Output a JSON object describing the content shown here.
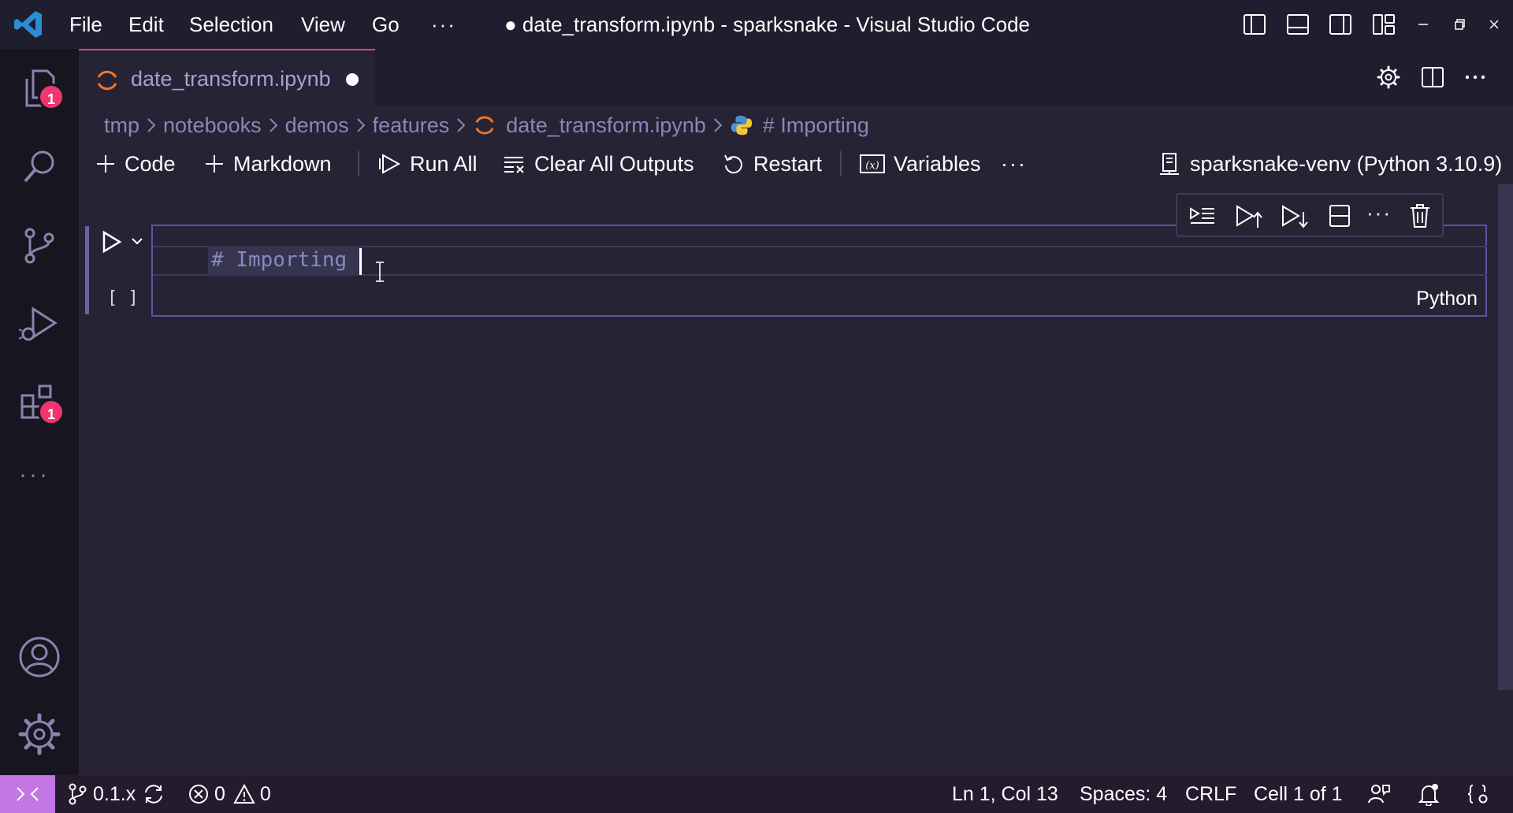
{
  "titlebar": {
    "menu": [
      "File",
      "Edit",
      "Selection",
      "View",
      "Go"
    ],
    "overflow": "···",
    "window_title": "● date_transform.ipynb - sparksnake - Visual Studio Code"
  },
  "activitybar": {
    "explorer_badge": "1",
    "extensions_badge": "1",
    "more": "···"
  },
  "tab": {
    "label": "date_transform.ipynb",
    "modified": true
  },
  "breadcrumb": {
    "parts": [
      "tmp",
      "notebooks",
      "demos",
      "features"
    ],
    "file": "date_transform.ipynb",
    "symbol": "# Importing"
  },
  "toolbar": {
    "code": "Code",
    "markdown": "Markdown",
    "run_all": "Run All",
    "clear_outputs": "Clear All Outputs",
    "restart": "Restart",
    "variables": "Variables",
    "more": "···",
    "kernel": "sparksnake-venv (Python 3.10.9)"
  },
  "cell": {
    "execution_count": "[ ]",
    "code": "# Importing ",
    "language": "Python",
    "toolbar_more": "···"
  },
  "statusbar": {
    "branch": "0.1.x",
    "errors": "0",
    "warnings": "0",
    "position": "Ln 1, Col 13",
    "spaces": "Spaces: 4",
    "eol": "CRLF",
    "cell": "Cell 1 of 1"
  },
  "colors": {
    "editor_bg": "#262335",
    "activitybar_bg": "#171520",
    "badge": "#f0366f",
    "remote": "#c376e4",
    "tab_accent": "#e14577"
  }
}
